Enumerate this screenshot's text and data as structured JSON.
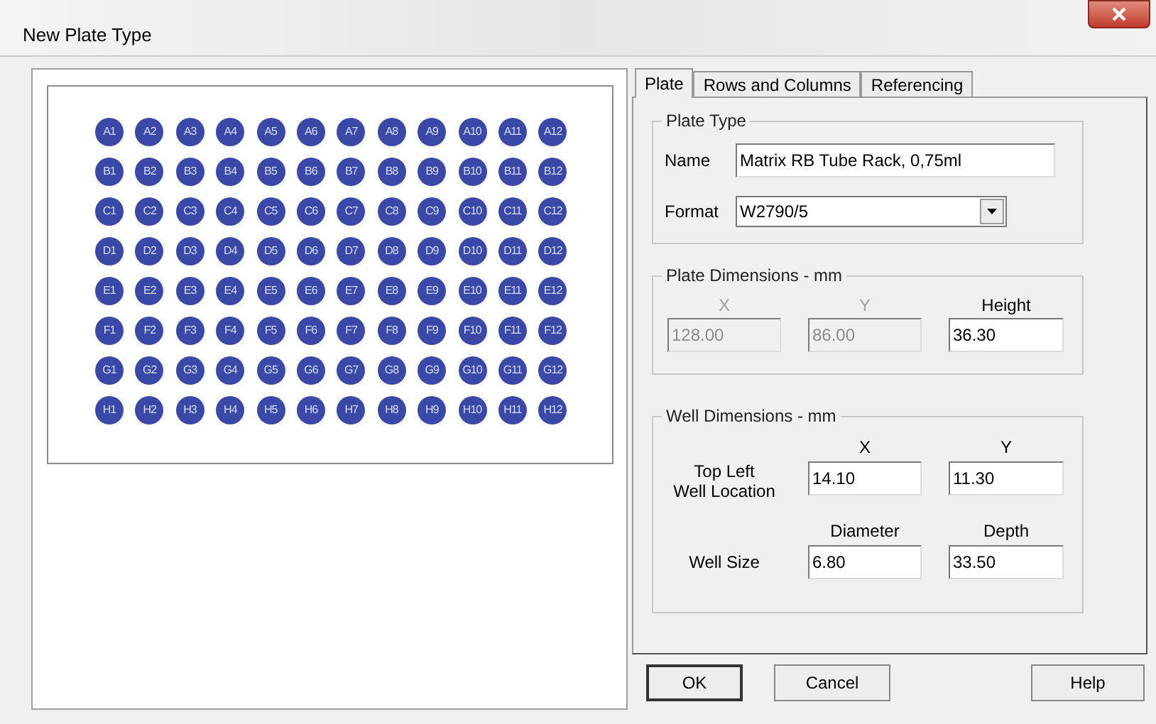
{
  "window": {
    "title": "New Plate Type"
  },
  "plate": {
    "wells": [
      [
        "A1",
        "A2",
        "A3",
        "A4",
        "A5",
        "A6",
        "A7",
        "A8",
        "A9",
        "A10",
        "A11",
        "A12"
      ],
      [
        "B1",
        "B2",
        "B3",
        "B4",
        "B5",
        "B6",
        "B7",
        "B8",
        "B9",
        "B10",
        "B11",
        "B12"
      ],
      [
        "C1",
        "C2",
        "C3",
        "C4",
        "C5",
        "C6",
        "C7",
        "C8",
        "C9",
        "C10",
        "C11",
        "C12"
      ],
      [
        "D1",
        "D2",
        "D3",
        "D4",
        "D5",
        "D6",
        "D7",
        "D8",
        "D9",
        "D10",
        "D11",
        "D12"
      ],
      [
        "E1",
        "E2",
        "E3",
        "E4",
        "E5",
        "E6",
        "E7",
        "E8",
        "E9",
        "E10",
        "E11",
        "E12"
      ],
      [
        "F1",
        "F2",
        "F3",
        "F4",
        "F5",
        "F6",
        "F7",
        "F8",
        "F9",
        "F10",
        "F11",
        "F12"
      ],
      [
        "G1",
        "G2",
        "G3",
        "G4",
        "G5",
        "G6",
        "G7",
        "G8",
        "G9",
        "G10",
        "G11",
        "G12"
      ],
      [
        "H1",
        "H2",
        "H3",
        "H4",
        "H5",
        "H6",
        "H7",
        "H8",
        "H9",
        "H10",
        "H11",
        "H12"
      ]
    ]
  },
  "tabs": [
    {
      "label": "Plate",
      "selected": true
    },
    {
      "label": "Rows and Columns",
      "selected": false
    },
    {
      "label": "Referencing",
      "selected": false
    }
  ],
  "plate_type": {
    "title": "Plate Type",
    "name_label": "Name",
    "name_value": "Matrix RB Tube Rack, 0,75ml",
    "format_label": "Format",
    "format_value": "W2790/5"
  },
  "plate_dimensions": {
    "title": "Plate Dimensions - mm",
    "fields": [
      {
        "label": "X",
        "value": "128.00",
        "disabled": true
      },
      {
        "label": "Y",
        "value": "86.00",
        "disabled": true
      },
      {
        "label": "Height",
        "value": "36.30",
        "disabled": false
      }
    ]
  },
  "well_dimensions": {
    "title": "Well Dimensions - mm",
    "rows": [
      {
        "label_lines": [
          "Top Left",
          "Well Location"
        ],
        "fields": [
          {
            "label": "X",
            "value": "14.10"
          },
          {
            "label": "Y",
            "value": "11.30"
          }
        ]
      },
      {
        "label_lines": [
          "Well Size"
        ],
        "fields": [
          {
            "label": "Diameter",
            "value": "6.80"
          },
          {
            "label": "Depth",
            "value": "33.50"
          }
        ]
      }
    ]
  },
  "buttons": [
    {
      "label": "OK",
      "default": true
    },
    {
      "label": "Cancel",
      "default": false
    },
    {
      "label": "Help",
      "default": false
    }
  ]
}
